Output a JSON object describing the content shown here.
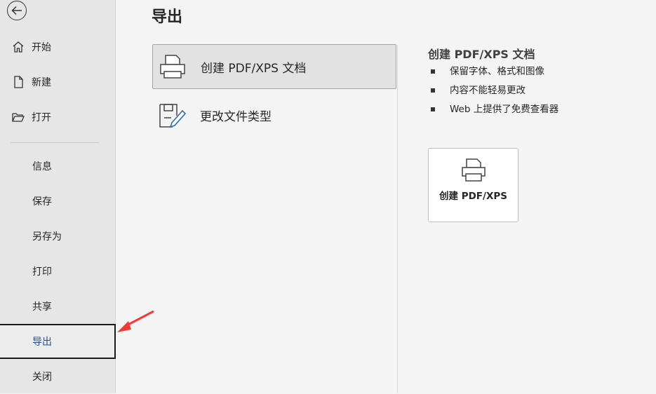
{
  "sidebar": {
    "top_items": [
      {
        "label": "开始",
        "icon": "home-icon"
      },
      {
        "label": "新建",
        "icon": "new-document-icon"
      },
      {
        "label": "打开",
        "icon": "folder-open-icon"
      }
    ],
    "bottom_items": [
      {
        "label": "信息"
      },
      {
        "label": "保存"
      },
      {
        "label": "另存为"
      },
      {
        "label": "打印"
      },
      {
        "label": "共享"
      },
      {
        "label": "导出",
        "selected": true
      },
      {
        "label": "关闭"
      }
    ]
  },
  "main": {
    "title": "导出",
    "options": [
      {
        "label": "创建 PDF/XPS 文档",
        "icon": "printer-pdf-icon",
        "active": true
      },
      {
        "label": "更改文件类型",
        "icon": "change-file-type-icon",
        "active": false
      }
    ]
  },
  "detail": {
    "title": "创建 PDF/XPS 文档",
    "bullets": [
      "保留字体、格式和图像",
      "内容不能轻易更改",
      "Web 上提供了免费查看器"
    ],
    "button_label": "创建 PDF/XPS"
  },
  "colors": {
    "sidebar_bg": "#e6e6e6",
    "main_bg": "#f4f4f4",
    "selected_text": "#1f4e9d",
    "annotation_arrow": "#f03a3a"
  }
}
